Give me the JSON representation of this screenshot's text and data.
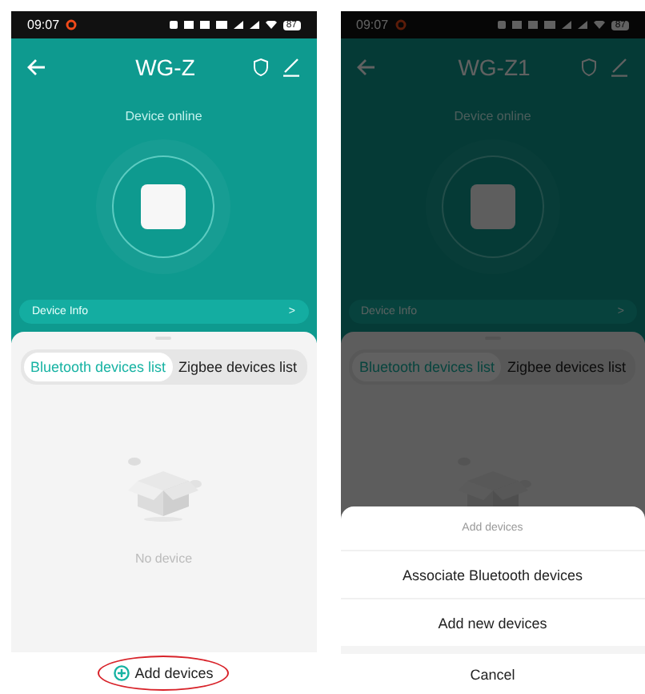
{
  "screens": [
    {
      "status_bar": {
        "time": "09:07",
        "battery": "87"
      },
      "title": "WG-Z",
      "status": "Device online",
      "device_info": {
        "label": "Device Info",
        "chevron": ">"
      },
      "tabs": [
        {
          "label": "Bluetooth devices list",
          "selected": true
        },
        {
          "label": "Zigbee devices list",
          "selected": false
        }
      ],
      "empty_text": "No device",
      "add_button": {
        "label": "Add devices",
        "highlighted": true
      },
      "dimmed": false
    },
    {
      "status_bar": {
        "time": "09:07",
        "battery": "87"
      },
      "title": "WG-Z1",
      "status": "Device online",
      "device_info": {
        "label": "Device Info",
        "chevron": ">"
      },
      "tabs": [
        {
          "label": "Bluetooth devices list",
          "selected": true
        },
        {
          "label": "Zigbee devices list",
          "selected": false
        }
      ],
      "dimmed": true,
      "action_sheet": {
        "title": "Add devices",
        "options": [
          "Associate Bluetooth devices",
          "Add new devices"
        ],
        "cancel": "Cancel"
      }
    }
  ]
}
